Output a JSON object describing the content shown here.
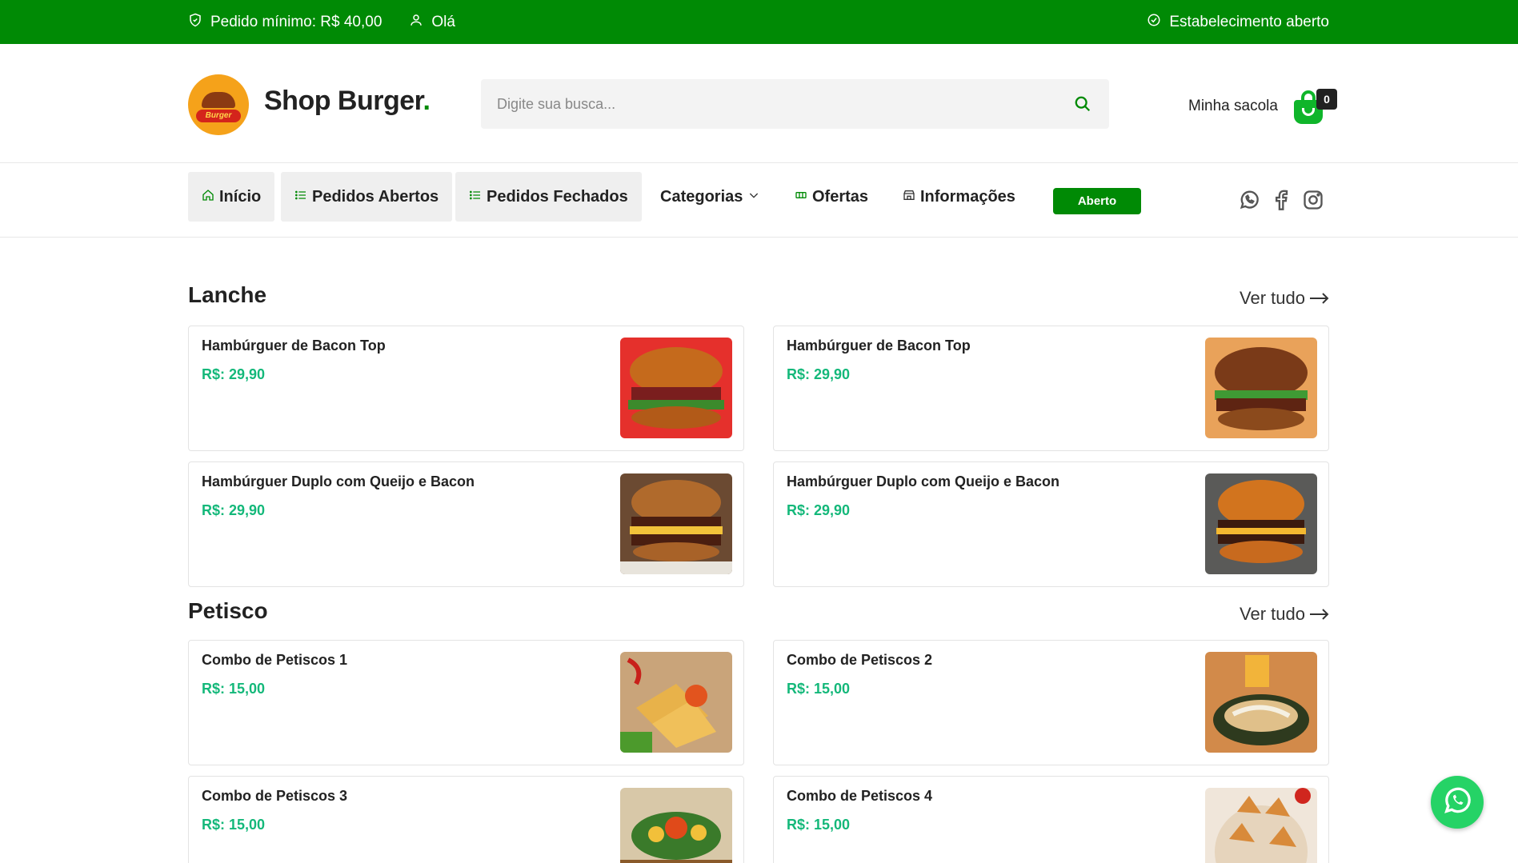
{
  "topbar": {
    "min_order": "Pedido mínimo: R$ 40,00",
    "greeting": "Olá",
    "status": "Estabelecimento aberto"
  },
  "header": {
    "logo_text": "Burger",
    "brand_name": "Shop Burger",
    "brand_dot": ".",
    "search_placeholder": "Digite sua busca...",
    "bag_label": "Minha sacola",
    "bag_count": "0"
  },
  "nav": {
    "home": "Início",
    "open_orders": "Pedidos Abertos",
    "closed_orders": "Pedidos Fechados",
    "categories": "Categorias",
    "offers": "Ofertas",
    "info": "Informações",
    "status_pill": "Aberto"
  },
  "sections": [
    {
      "title": "Lanche",
      "see_all": "Ver tudo",
      "items": [
        {
          "name": "Hambúrguer de Bacon Top",
          "price": "R$: 29,90"
        },
        {
          "name": "Hambúrguer de Bacon Top",
          "price": "R$: 29,90"
        },
        {
          "name": "Hambúrguer Duplo com Queijo e Bacon",
          "price": "R$: 29,90"
        },
        {
          "name": "Hambúrguer Duplo com Queijo e Bacon",
          "price": "R$: 29,90"
        }
      ]
    },
    {
      "title": "Petisco",
      "see_all": "Ver tudo",
      "items": [
        {
          "name": "Combo de Petiscos 1",
          "price": "R$: 15,00"
        },
        {
          "name": "Combo de Petiscos 2",
          "price": "R$: 15,00"
        },
        {
          "name": "Combo de Petiscos 3",
          "price": "R$: 15,00"
        },
        {
          "name": "Combo de Petiscos 4",
          "price": "R$: 15,00"
        }
      ]
    }
  ],
  "colors": {
    "brand_green": "#008a05",
    "price_green": "#14b87a",
    "whatsapp": "#25d366"
  }
}
